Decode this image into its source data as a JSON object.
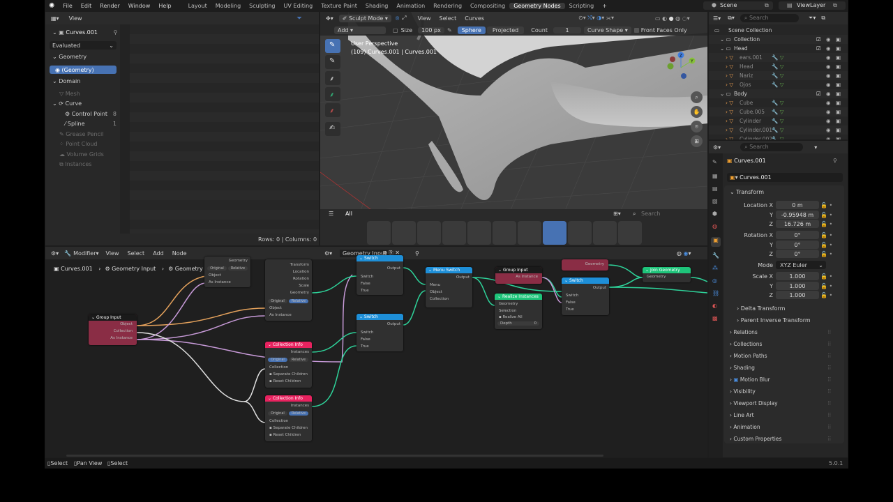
{
  "menu": {
    "items": [
      "File",
      "Edit",
      "Render",
      "Window",
      "Help"
    ],
    "workspaces": [
      "Layout",
      "Modeling",
      "Sculpting",
      "UV Editing",
      "Texture Paint",
      "Shading",
      "Animation",
      "Rendering",
      "Compositing",
      "Geometry Nodes",
      "Scripting"
    ],
    "active_workspace": "Geometry Nodes",
    "add_tab": "+",
    "scene": "Scene",
    "view_layer": "ViewLayer"
  },
  "spreadsheet": {
    "view_label": "View",
    "object": "Curves.001",
    "evaluated": "Evaluated",
    "geometry_label": "Geometry",
    "geometry_item": "(Geometry)",
    "domain_label": "Domain",
    "domains": [
      {
        "label": "Mesh",
        "count": ""
      },
      {
        "label": "Curve",
        "count": ""
      },
      {
        "label": "Control Point",
        "count": "8"
      },
      {
        "label": "Spline",
        "count": "1"
      },
      {
        "label": "Grease Pencil",
        "count": ""
      },
      {
        "label": "Point Cloud",
        "count": ""
      },
      {
        "label": "Volume Grids",
        "count": ""
      },
      {
        "label": "Instances",
        "count": ""
      }
    ],
    "rows": "Rows: 0",
    "columns": "Columns: 0"
  },
  "viewport": {
    "mode": "Sculpt Mode",
    "menus": [
      "View",
      "Select",
      "Curves"
    ],
    "add": "Add",
    "size_label": "Size",
    "size_value": "100 px",
    "sphere": "Sphere",
    "projected": "Projected",
    "count_label": "Count",
    "count_value": "1",
    "curve_shape": "Curve Shape",
    "front_faces": "Front Faces Only",
    "perspective": "User Perspective",
    "object_info": "(109) Curves.001 | Curves.001",
    "asset_all": "All",
    "search_placeholder": "Search",
    "gizmo": {
      "x": "X",
      "y": "Y",
      "z": "Z"
    }
  },
  "node_editor": {
    "menus": [
      "Modifier",
      "View",
      "Select",
      "Add",
      "Node"
    ],
    "tree_name": "Geometry Input",
    "breadcrumb": [
      "Curves.001",
      "Geometry Input",
      "Geometry Input"
    ],
    "nodes": {
      "group_input": {
        "title": "Group Input",
        "sockets": [
          "Object",
          "Collection",
          "As Instance"
        ]
      },
      "obj_info": {
        "sockets": [
          "Transform",
          "Location",
          "Rotation",
          "Scale",
          "Geometry",
          "Original",
          "Relative",
          "Object",
          "As Instance"
        ]
      },
      "top_small": {
        "sockets": [
          "Geometry",
          "Original",
          "Relative",
          "Object",
          "As Instance"
        ]
      },
      "coll1": {
        "title": "Collection Info",
        "sockets": [
          "Instances",
          "Original",
          "Relative",
          "Collection",
          "Separate Children",
          "Reset Children"
        ]
      },
      "coll2": {
        "title": "Collection Info",
        "sockets": [
          "Instances",
          "Original",
          "Relative",
          "Collection",
          "Separate Children",
          "Reset Children"
        ]
      },
      "switch1": {
        "title": "Switch",
        "sockets": [
          "Output",
          "Switch",
          "False",
          "True"
        ]
      },
      "switch2": {
        "title": "Switch",
        "sockets": [
          "Output",
          "Switch",
          "False",
          "True"
        ]
      },
      "menu_switch": {
        "title": "Menu Switch",
        "sockets": [
          "Output",
          "Menu",
          "Object",
          "Collection"
        ]
      },
      "group_input2": {
        "title": "Group Input",
        "sockets": [
          "As Instance"
        ]
      },
      "realize": {
        "title": "Realize Instances",
        "sockets": [
          "Geometry",
          "Geometry",
          "Selection",
          "Realize All",
          "Depth",
          "0"
        ]
      },
      "geometry_pink": {
        "sockets": [
          "Geometry"
        ]
      },
      "switch3": {
        "title": "Switch",
        "sockets": [
          "Output",
          "Switch",
          "False",
          "True"
        ]
      },
      "join": {
        "title": "Join Geometry",
        "sockets": [
          "Geometry"
        ]
      }
    }
  },
  "outliner": {
    "search_placeholder": "Search",
    "items": [
      {
        "label": "Scene Collection",
        "indent": 0
      },
      {
        "label": "Collection",
        "indent": 1
      },
      {
        "label": "Head",
        "indent": 1
      },
      {
        "label": "ears.001",
        "indent": 2
      },
      {
        "label": "Head",
        "indent": 2
      },
      {
        "label": "Nariz",
        "indent": 2
      },
      {
        "label": "Ojos",
        "indent": 2
      },
      {
        "label": "Body",
        "indent": 1
      },
      {
        "label": "Cube",
        "indent": 2
      },
      {
        "label": "Cube.005",
        "indent": 2
      },
      {
        "label": "Cylinder",
        "indent": 2
      },
      {
        "label": "Cylinder.001",
        "indent": 2
      },
      {
        "label": "Cylinder.002",
        "indent": 2
      }
    ]
  },
  "properties": {
    "search_placeholder": "Search",
    "object": "Curves.001",
    "object_field": "Curves.001",
    "transform": "Transform",
    "location_x_label": "Location X",
    "location": [
      "0 m",
      "-0.95948 m",
      "16.726 m"
    ],
    "rotation_x_label": "Rotation X",
    "rotation": [
      "0°",
      "0°",
      "0°"
    ],
    "mode_label": "Mode",
    "mode": "XYZ Euler",
    "scale_x_label": "Scale X",
    "scale": [
      "1.000",
      "1.000",
      "1.000"
    ],
    "axis_y": "Y",
    "axis_z": "Z",
    "delta": "Delta Transform",
    "parent_inverse": "Parent Inverse Transform",
    "sections": [
      "Relations",
      "Collections",
      "Motion Paths",
      "Shading",
      "Motion Blur",
      "Visibility",
      "Viewport Display",
      "Line Art",
      "Animation",
      "Custom Properties"
    ]
  },
  "status": {
    "items": [
      "Select",
      "Pan View",
      "Select"
    ],
    "version": "5.0.1"
  },
  "colors": {
    "accent": "#4772b3",
    "node_pink": "#e8225f",
    "node_blue": "#1e8fd8",
    "node_green": "#1ec47a",
    "wire_green": "#2ed39a",
    "wire_orange": "#e5a25c",
    "wire_pink": "#c79ad8",
    "wire_white": "#e0e0e0"
  }
}
